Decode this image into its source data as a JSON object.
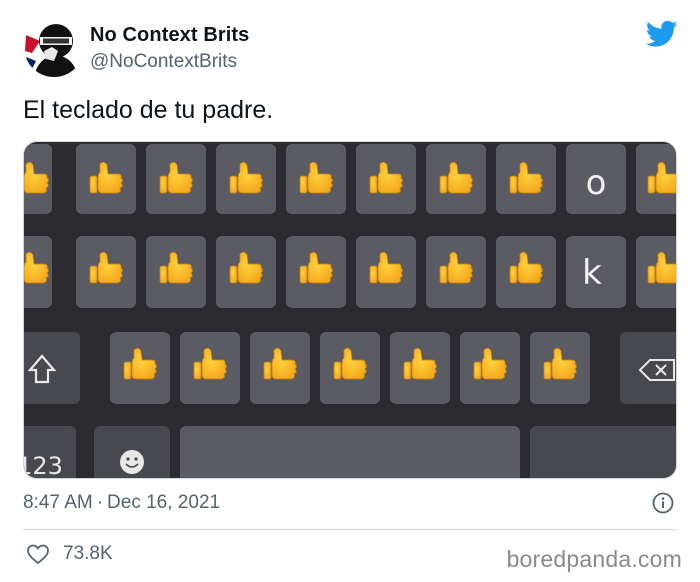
{
  "author": {
    "display_name": "No Context Brits",
    "handle": "@NoContextBrits",
    "avatar_icon": "masked-figure-avatar-icon"
  },
  "brand_icon": "twitter-bird-icon",
  "tweet": {
    "text": "El teclado de tu padre."
  },
  "media": {
    "description_icon": "keyboard-image",
    "rows": [
      {
        "keys": [
          "👍",
          "👍",
          "👍",
          "👍",
          "👍",
          "👍",
          "👍",
          "👍",
          "o",
          "👍"
        ]
      },
      {
        "keys": [
          "👍",
          "👍",
          "👍",
          "👍",
          "👍",
          "👍",
          "👍",
          "👍",
          "k",
          "👍"
        ]
      },
      {
        "keys": [
          "👍",
          "👍",
          "👍",
          "👍",
          "👍",
          "👍",
          "👍"
        ]
      }
    ],
    "numeric_key": "123",
    "accent_key_bg": "#5b5b63",
    "keyboard_bg": "#2b2b30"
  },
  "meta": {
    "time": "8:47 AM",
    "separator": "·",
    "date": "Dec 16, 2021"
  },
  "engagement": {
    "likes": "73.8K"
  },
  "watermark": "boredpanda.com",
  "colors": {
    "twitter_blue": "#1d9bf0",
    "secondary_text": "#536471",
    "divider": "#cfd9de"
  }
}
